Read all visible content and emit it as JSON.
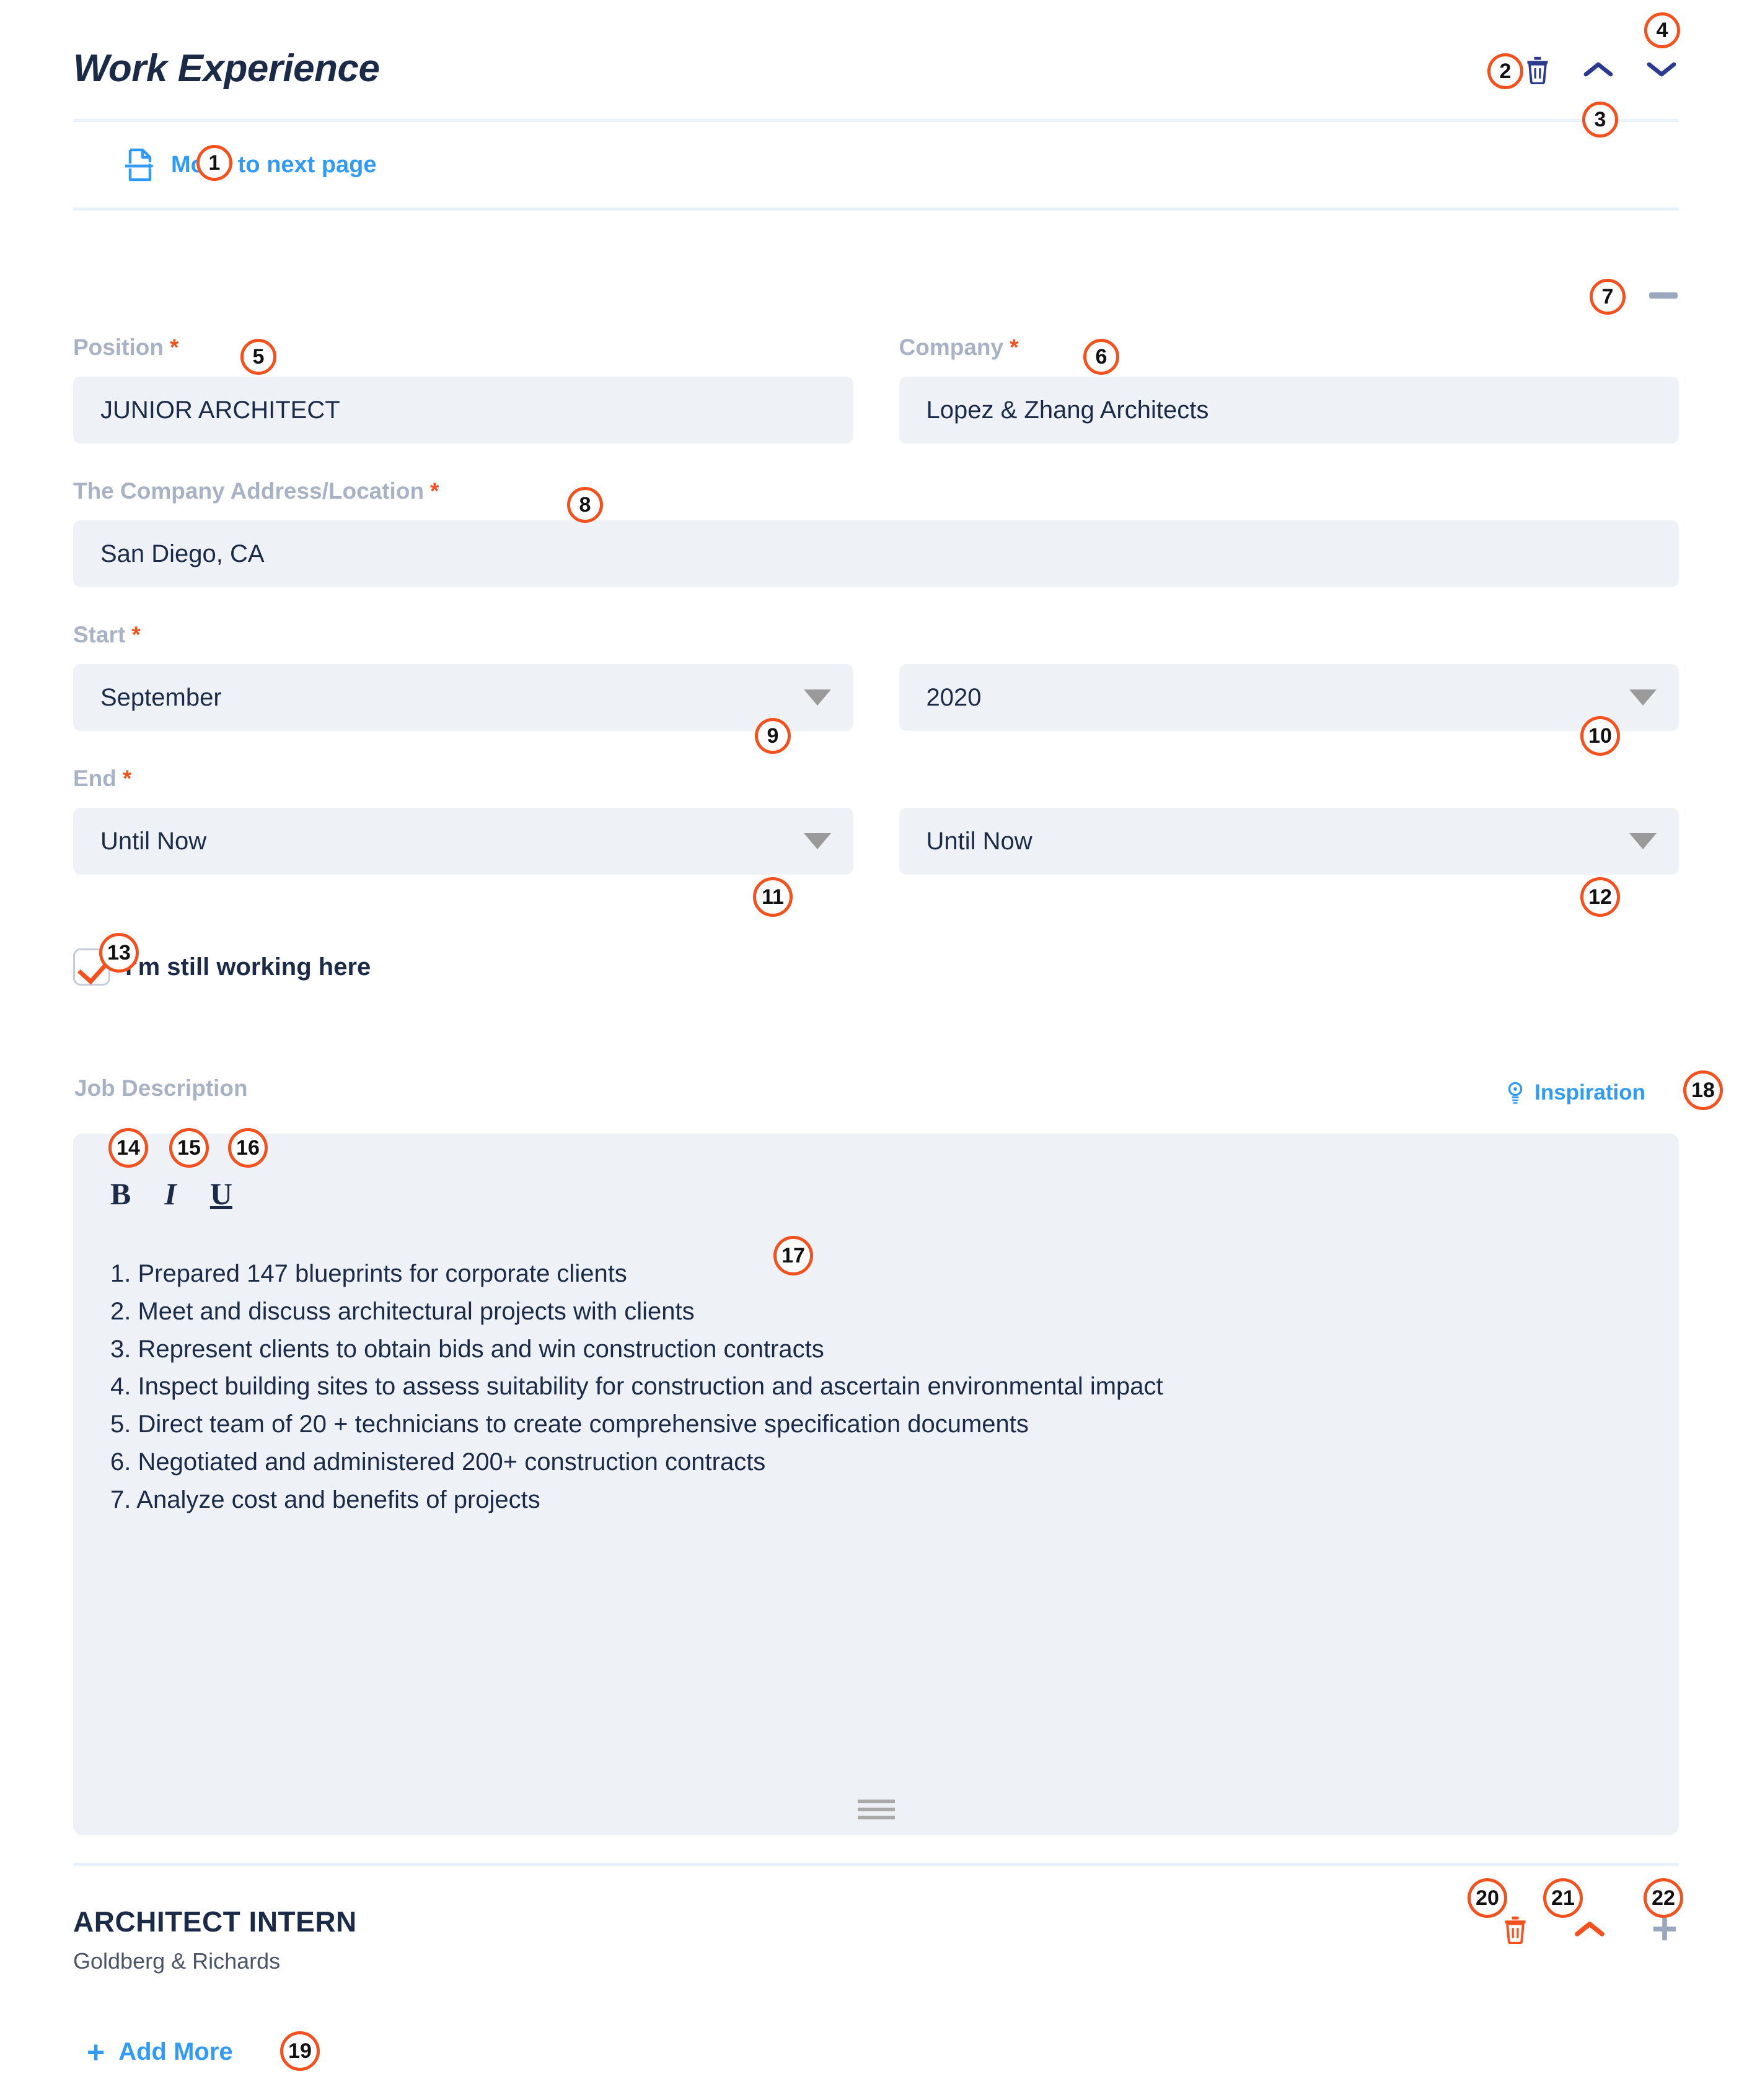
{
  "header": {
    "title": "Work Experience",
    "move_to_next_page": "Move to next page",
    "icons": {
      "delete": "trash-icon",
      "collapse_up": "chevron-up-icon",
      "expand_down": "chevron-down-icon",
      "minimize": "minus-icon"
    }
  },
  "form": {
    "position": {
      "label": "Position",
      "required": "*",
      "value": "JUNIOR ARCHITECT"
    },
    "company": {
      "label": "Company",
      "required": "*",
      "value": "Lopez & Zhang Architects"
    },
    "address": {
      "label": "The Company Address/Location",
      "required": "*",
      "value": "San Diego, CA"
    },
    "start": {
      "label": "Start",
      "required": "*",
      "month": "September",
      "year": "2020"
    },
    "end": {
      "label": "End",
      "required": "*",
      "month": "Until Now",
      "year": "Until Now"
    },
    "still_working": {
      "label": "I'm still working here",
      "checked": true
    }
  },
  "job_description": {
    "label": "Job Description",
    "inspiration_label": "Inspiration",
    "toolbar": {
      "bold": "B",
      "italic": "I",
      "underline": "U"
    },
    "lines": [
      "1. Prepared 147 blueprints for corporate clients",
      "2. Meet and discuss architectural projects with clients",
      "3. Represent clients to obtain bids and win construction contracts",
      "4. Inspect building sites to assess suitability for construction and ascertain environmental impact",
      "5. Direct team of 20 + technicians to create comprehensive specification documents",
      "6. Negotiated and administered 200+ construction contracts",
      "7. Analyze cost and benefits of projects"
    ]
  },
  "next_entry": {
    "title": "ARCHITECT INTERN",
    "company": "Goldberg & Richards"
  },
  "add_more": {
    "label": "Add More",
    "icon": "plus-icon"
  },
  "markers": {
    "m1": "1",
    "m2": "2",
    "m3": "3",
    "m4": "4",
    "m5": "5",
    "m6": "6",
    "m7": "7",
    "m8": "8",
    "m9": "9",
    "m10": "10",
    "m11": "11",
    "m12": "12",
    "m13": "13",
    "m14": "14",
    "m15": "15",
    "m16": "16",
    "m17": "17",
    "m18": "18",
    "m19": "19",
    "m20": "20",
    "m21": "21",
    "m22": "22"
  },
  "colors": {
    "accent_blue": "#2f9bf6",
    "accent_orange": "#f4511e",
    "navy": "#1b2a47",
    "label_gray": "#a8b2c5",
    "field_bg": "#eef2f7",
    "divider": "#e8f2fd"
  }
}
